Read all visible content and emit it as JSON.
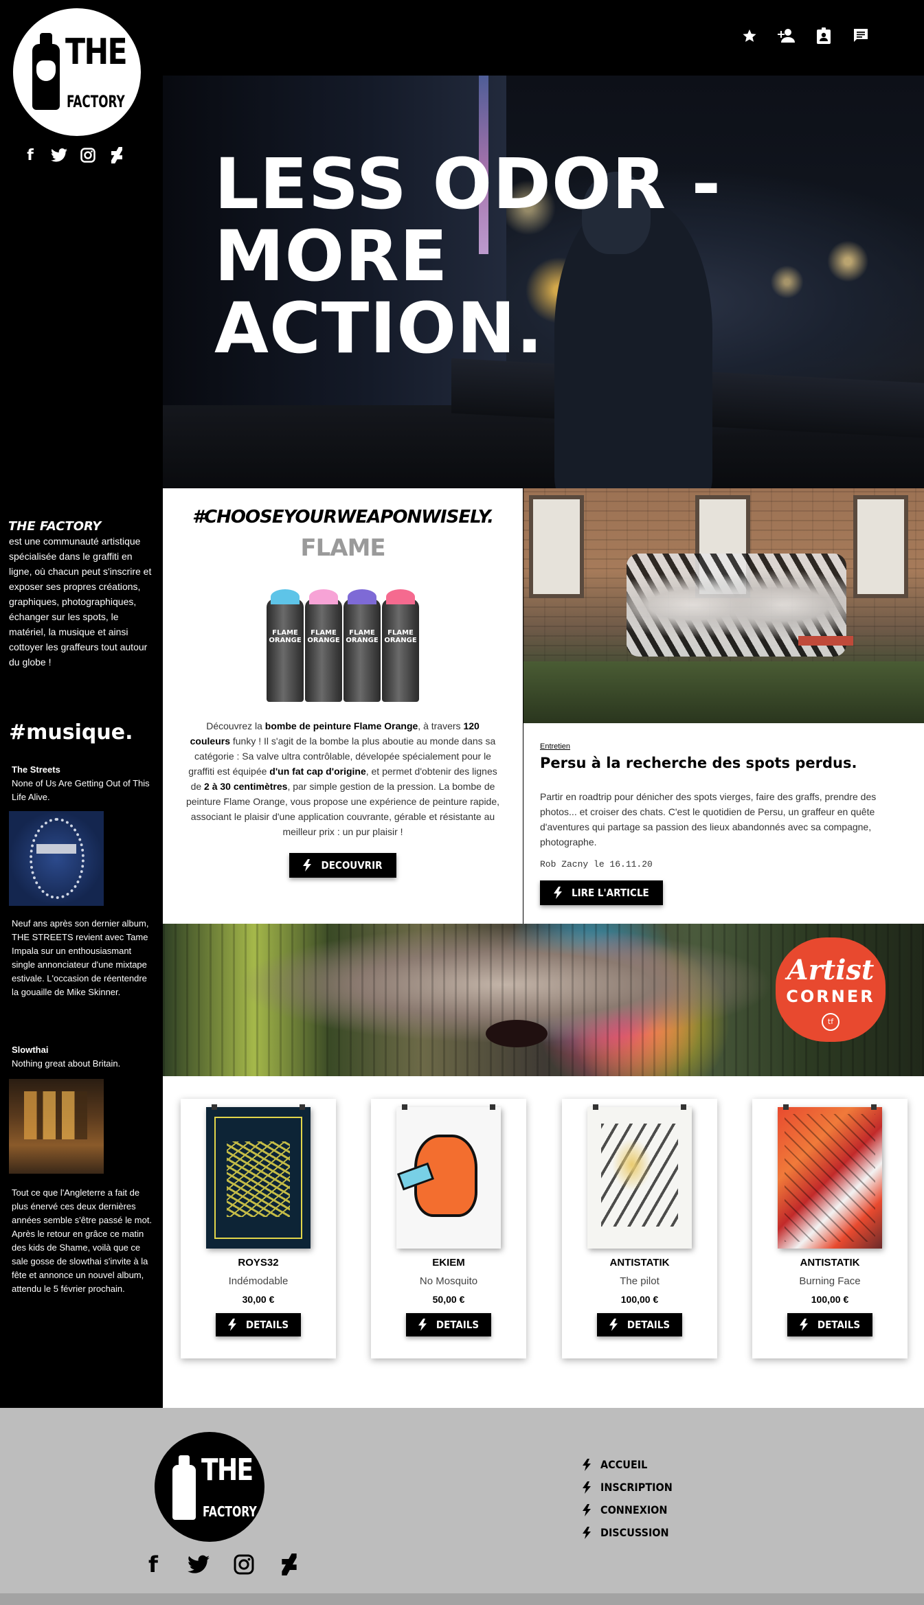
{
  "brand": {
    "logo_top": "THE",
    "logo_bottom": "FACTORY"
  },
  "social": [
    "facebook-icon",
    "twitter-icon",
    "instagram-icon",
    "deviantart-icon"
  ],
  "top_icons": [
    "star-icon",
    "add-user-icon",
    "profile-badge-icon",
    "chat-icon"
  ],
  "hero": {
    "line1": "LESS ODOR -",
    "line2": "MORE",
    "line3": "ACTION."
  },
  "sidebar": {
    "title": "THE FACTORY",
    "description": "est une communauté artistique spécialisée dans le graffiti en ligne, où chacun peut s'inscrire et exposer ses propres créations, graphiques, photographiques, échanger sur les spots, le matériel, la musique et ainsi cottoyer les graffeurs tout autour du globe !",
    "music_heading": "#musique.",
    "tracks": [
      {
        "artist": "The Streets",
        "title": "None of Us Are Getting Out of This Life Alive.",
        "text": "Neuf ans après son dernier album, THE STREETS revient avec Tame Impala sur un enthousiasmant single annonciateur d'une mixtape estivale. L'occasion de réentendre la gouaille de Mike Skinner."
      },
      {
        "artist": "Slowthai",
        "title": "Nothing great about Britain.",
        "text": "Tout ce que l'Angleterre a fait de plus énervé ces deux dernières années semble s'être passé le mot. Après le retour en grâce ce matin des kids de Shame, voilà que ce sale gosse de slowthai s'invite à la fête et annonce un nouvel album, attendu le 5 février prochain."
      }
    ]
  },
  "promo": {
    "tag": "#CHOOSEYOURWEAPONWISELY.",
    "brand": "FLAME",
    "can_label": "FLAME ORANGE",
    "text_1": "Découvrez la ",
    "text_b1": "bombe de peinture Flame Orange",
    "text_2": ", à travers ",
    "text_b2": "120 couleurs",
    "text_3": " funky ! Il s'agit de la bombe la plus aboutie au monde dans sa catégorie : Sa valve ultra contrôlable, dévelopée spécialement pour le graffiti est équipée ",
    "text_b3": "d'un fat cap d'origine",
    "text_4": ", et permet d'obtenir des lignes de ",
    "text_b4": "2 à 30 centimètres",
    "text_5": ", par simple gestion de la pression. La bombe de peinture Flame Orange, vous propose une expérience de peinture rapide, associant le plaisir d'une application couvrante, gérable et résistante au meilleur prix : un pur plaisir !",
    "button": "DECOUVRIR"
  },
  "article": {
    "category": "Entretien",
    "title": "Persu à la recherche des spots perdus.",
    "text": "Partir en roadtrip pour dénicher des spots vierges, faire des graffs, prendre des photos... et croiser des chats. C'est le quotidien de Persu, un graffeur en quête d'aventures qui partage sa passion des lieux abandonnés avec sa compagne, photographe.",
    "byline": "Rob Zacny le 16.11.20",
    "button": "LIRE L'ARTICLE"
  },
  "banner": {
    "badge_line1": "Artist",
    "badge_line2": "CORNER",
    "badge_mark": "tf"
  },
  "products": [
    {
      "artist": "ROYS32",
      "title": "Indémodable",
      "price": "30,00 €",
      "button": "DETAILS"
    },
    {
      "artist": "EKIEM",
      "title": "No Mosquito",
      "price": "50,00 €",
      "button": "DETAILS"
    },
    {
      "artist": "ANTISTATIK",
      "title": "The pilot",
      "price": "100,00 €",
      "button": "DETAILS"
    },
    {
      "artist": "ANTISTATIK",
      "title": "Burning Face",
      "price": "100,00 €",
      "button": "DETAILS"
    }
  ],
  "footer": {
    "nav": [
      "ACCUEIL",
      "INSCRIPTION",
      "CONNEXION",
      "DISCUSSION"
    ]
  },
  "colors": {
    "background": "#000000",
    "footer": "#bdbdbd",
    "accent_badge": "#e8492f",
    "button": "#000000"
  }
}
